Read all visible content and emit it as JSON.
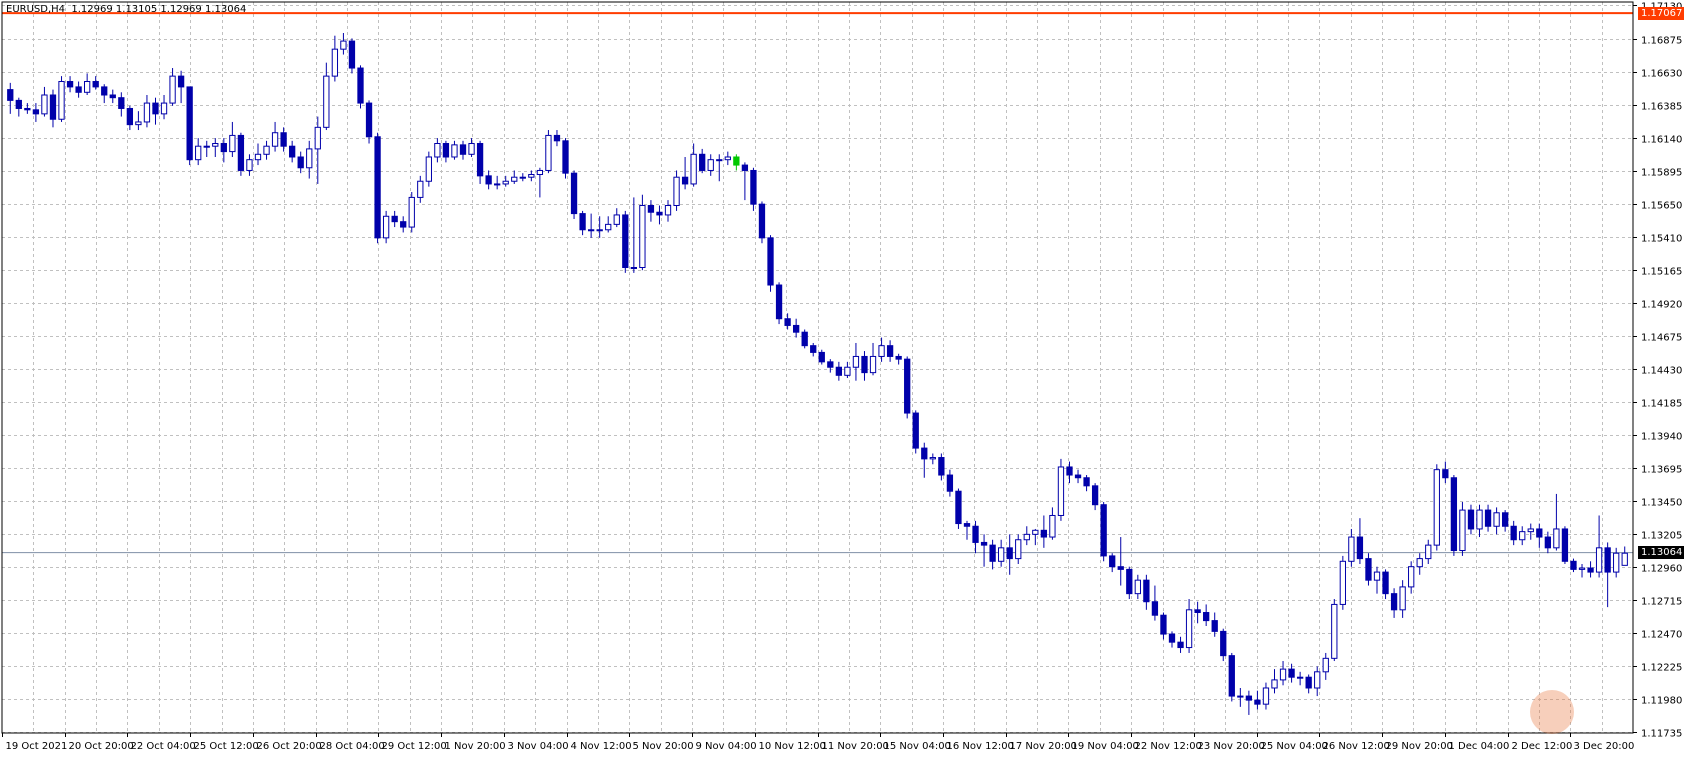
{
  "chart_data": {
    "type": "candlestick",
    "title": "EURUSD,H4  1.12969 1.13105 1.12969 1.13064",
    "symbol": "EURUSD",
    "timeframe": "H4",
    "ohlc_header": [
      "1.12969",
      "1.13105",
      "1.12969",
      "1.13064"
    ],
    "ylim": [
      1.11726,
      1.1715
    ],
    "y_ticks": [
      "1.17130",
      "1.16875",
      "1.16630",
      "1.16385",
      "1.16140",
      "1.15895",
      "1.15650",
      "1.15410",
      "1.15165",
      "1.14920",
      "1.14675",
      "1.14430",
      "1.14185",
      "1.13940",
      "1.13695",
      "1.13450",
      "1.13205",
      "1.12960",
      "1.12715",
      "1.12470",
      "1.12225",
      "1.11980",
      "1.11735"
    ],
    "x_ticks": [
      "19 Oct 2021",
      "20 Oct 20:00",
      "22 Oct 04:00",
      "25 Oct 12:00",
      "26 Oct 20:00",
      "28 Oct 04:00",
      "29 Oct 12:00",
      "1 Nov 20:00",
      "3 Nov 04:00",
      "4 Nov 12:00",
      "5 Nov 20:00",
      "9 Nov 04:00",
      "10 Nov 12:00",
      "11 Nov 20:00",
      "15 Nov 04:00",
      "16 Nov 12:00",
      "17 Nov 20:00",
      "19 Nov 04:00",
      "22 Nov 12:00",
      "23 Nov 20:00",
      "25 Nov 04:00",
      "26 Nov 12:00",
      "29 Nov 20:00",
      "1 Dec 04:00",
      "2 Dec 12:00",
      "3 Dec 20:00"
    ],
    "level_line": {
      "price": "1.17067",
      "color": "#ff3c00"
    },
    "bid_line": {
      "price": "1.13064",
      "color": "#000000"
    },
    "grid": true,
    "colors": {
      "bull": "#0000aa",
      "bear": "#0000aa",
      "highlight": "#00c800",
      "grid": "#c0c0c0"
    },
    "closes": [
      1.1642,
      1.1636,
      1.1635,
      1.1632,
      1.1646,
      1.1628,
      1.1656,
      1.1652,
      1.1648,
      1.1656,
      1.1652,
      1.1646,
      1.1644,
      1.1636,
      1.1624,
      1.1626,
      1.164,
      1.1632,
      1.164,
      1.166,
      1.1652,
      1.1598,
      1.1608,
      1.1608,
      1.161,
      1.1604,
      1.1616,
      1.159,
      1.1598,
      1.1602,
      1.1608,
      1.1618,
      1.1608,
      1.16,
      1.1592,
      1.1606,
      1.1622,
      1.166,
      1.168,
      1.1686,
      1.1666,
      1.164,
      1.1615,
      1.154,
      1.1556,
      1.1552,
      1.1548,
      1.157,
      1.1582,
      1.16,
      1.161,
      1.16,
      1.1609,
      1.1602,
      1.161,
      1.1586,
      1.158,
      1.158,
      1.1582,
      1.1585,
      1.1585,
      1.1587,
      1.159,
      1.1616,
      1.1612,
      1.1588,
      1.1558,
      1.1546,
      1.1546,
      1.1546,
      1.155,
      1.1557,
      1.1518,
      1.1518,
      1.1564,
      1.1559,
      1.1557,
      1.1564,
      1.1585,
      1.158,
      1.1602,
      1.159,
      1.1598,
      1.1598,
      1.16,
      1.1594,
      1.159,
      1.1565,
      1.154,
      1.1505,
      1.148,
      1.1475,
      1.147,
      1.146,
      1.1455,
      1.1448,
      1.1444,
      1.1438,
      1.1444,
      1.1452,
      1.144,
      1.1452,
      1.146,
      1.1452,
      1.145,
      1.141,
      1.1384,
      1.1376,
      1.1377,
      1.1364,
      1.1352,
      1.1328,
      1.1326,
      1.1314,
      1.1312,
      1.13,
      1.131,
      1.1302,
      1.1316,
      1.132,
      1.1323,
      1.1318,
      1.1334,
      1.137,
      1.1364,
      1.1362,
      1.1356,
      1.1342,
      1.1304,
      1.1296,
      1.1294,
      1.1276,
      1.1286,
      1.127,
      1.126,
      1.1246,
      1.124,
      1.1236,
      1.1264,
      1.1262,
      1.1256,
      1.1248,
      1.123,
      1.12,
      1.12,
      1.1197,
      1.1194,
      1.1206,
      1.1212,
      1.122,
      1.1214,
      1.1214,
      1.1206,
      1.1218,
      1.1228,
      1.1268,
      1.13,
      1.1318,
      1.1302,
      1.1286,
      1.1292,
      1.1276,
      1.1264,
      1.1281,
      1.1296,
      1.1302,
      1.1312,
      1.1368,
      1.1362,
      1.1308,
      1.1338,
      1.1324,
      1.1338,
      1.1326,
      1.1336,
      1.1326,
      1.1316,
      1.1322,
      1.1324,
      1.1318,
      1.131,
      1.1324,
      1.13,
      1.1294,
      1.1295,
      1.1292,
      1.131,
      1.1292,
      1.1306,
      1.1306
    ],
    "highlight_index": 85,
    "candles": [
      [
        1.165,
        1.1655,
        1.1632,
        1.1642
      ],
      [
        1.1642,
        1.1644,
        1.163,
        1.1636
      ],
      [
        1.1636,
        1.164,
        1.1632,
        1.1635
      ],
      [
        1.1635,
        1.164,
        1.1626,
        1.1632
      ],
      [
        1.1632,
        1.1652,
        1.163,
        1.1646
      ],
      [
        1.1646,
        1.165,
        1.1622,
        1.1628
      ],
      [
        1.1628,
        1.166,
        1.1626,
        1.1656
      ],
      [
        1.1656,
        1.166,
        1.1648,
        1.1652
      ],
      [
        1.1652,
        1.1656,
        1.1644,
        1.1648
      ],
      [
        1.1648,
        1.1662,
        1.1646,
        1.1656
      ],
      [
        1.1656,
        1.166,
        1.165,
        1.1652
      ],
      [
        1.1652,
        1.1654,
        1.164,
        1.1646
      ],
      [
        1.1646,
        1.165,
        1.164,
        1.1644
      ],
      [
        1.1644,
        1.1648,
        1.163,
        1.1636
      ],
      [
        1.1636,
        1.1638,
        1.162,
        1.1624
      ],
      [
        1.1624,
        1.1634,
        1.162,
        1.1626
      ],
      [
        1.1626,
        1.1646,
        1.1622,
        1.164
      ],
      [
        1.164,
        1.1644,
        1.1624,
        1.1632
      ],
      [
        1.1632,
        1.1646,
        1.1628,
        1.164
      ],
      [
        1.164,
        1.1666,
        1.1638,
        1.166
      ],
      [
        1.166,
        1.1664,
        1.164,
        1.1652
      ],
      [
        1.1652,
        1.1652,
        1.1594,
        1.1598
      ],
      [
        1.1598,
        1.1614,
        1.1594,
        1.1608
      ],
      [
        1.1608,
        1.1612,
        1.16,
        1.1608
      ],
      [
        1.1608,
        1.1614,
        1.16,
        1.161
      ],
      [
        1.161,
        1.1614,
        1.1596,
        1.1604
      ],
      [
        1.1604,
        1.1626,
        1.16,
        1.1616
      ],
      [
        1.1616,
        1.1618,
        1.1586,
        1.159
      ],
      [
        1.159,
        1.1602,
        1.1586,
        1.1598
      ],
      [
        1.1598,
        1.161,
        1.1594,
        1.1602
      ],
      [
        1.1602,
        1.1612,
        1.1598,
        1.1608
      ],
      [
        1.1608,
        1.1626,
        1.1604,
        1.1618
      ],
      [
        1.1618,
        1.1622,
        1.1604,
        1.1608
      ],
      [
        1.1608,
        1.1612,
        1.1596,
        1.16
      ],
      [
        1.16,
        1.1604,
        1.1588,
        1.1592
      ],
      [
        1.1592,
        1.1612,
        1.1584,
        1.1606
      ],
      [
        1.1606,
        1.163,
        1.158,
        1.1622
      ],
      [
        1.1622,
        1.167,
        1.162,
        1.166
      ],
      [
        1.166,
        1.169,
        1.1656,
        1.168
      ],
      [
        1.168,
        1.1692,
        1.1676,
        1.1686
      ],
      [
        1.1686,
        1.1688,
        1.1662,
        1.1666
      ],
      [
        1.1666,
        1.1668,
        1.1636,
        1.164
      ],
      [
        1.164,
        1.1642,
        1.161,
        1.1615
      ],
      [
        1.1615,
        1.1618,
        1.1536,
        1.154
      ],
      [
        1.154,
        1.156,
        1.1536,
        1.1556
      ],
      [
        1.1556,
        1.156,
        1.1548,
        1.1552
      ],
      [
        1.1552,
        1.1556,
        1.1544,
        1.1548
      ],
      [
        1.1548,
        1.1574,
        1.1544,
        1.157
      ],
      [
        1.157,
        1.1586,
        1.1566,
        1.1582
      ],
      [
        1.1582,
        1.1604,
        1.1578,
        1.16
      ],
      [
        1.16,
        1.1614,
        1.1596,
        1.161
      ],
      [
        1.161,
        1.1612,
        1.1596,
        1.16
      ],
      [
        1.16,
        1.1612,
        1.1598,
        1.1609
      ],
      [
        1.1609,
        1.1612,
        1.1598,
        1.1602
      ],
      [
        1.1602,
        1.1614,
        1.16,
        1.161
      ],
      [
        1.161,
        1.1612,
        1.158,
        1.1586
      ],
      [
        1.1586,
        1.159,
        1.1576,
        1.158
      ],
      [
        1.158,
        1.1586,
        1.1576,
        1.158
      ],
      [
        1.158,
        1.1586,
        1.1578,
        1.1582
      ],
      [
        1.1582,
        1.159,
        1.158,
        1.1585
      ],
      [
        1.1585,
        1.1588,
        1.1582,
        1.1585
      ],
      [
        1.1585,
        1.159,
        1.1582,
        1.1587
      ],
      [
        1.1587,
        1.1592,
        1.157,
        1.159
      ],
      [
        1.159,
        1.162,
        1.1588,
        1.1616
      ],
      [
        1.1616,
        1.162,
        1.1608,
        1.1612
      ],
      [
        1.1612,
        1.1614,
        1.1584,
        1.1588
      ],
      [
        1.1588,
        1.159,
        1.1554,
        1.1558
      ],
      [
        1.1558,
        1.156,
        1.1542,
        1.1546
      ],
      [
        1.1546,
        1.1558,
        1.154,
        1.1546
      ],
      [
        1.1546,
        1.1556,
        1.154,
        1.1546
      ],
      [
        1.1546,
        1.1556,
        1.1544,
        1.155
      ],
      [
        1.155,
        1.1562,
        1.1548,
        1.1557
      ],
      [
        1.1557,
        1.156,
        1.1514,
        1.1518
      ],
      [
        1.1518,
        1.157,
        1.1514,
        1.1518
      ],
      [
        1.1518,
        1.1572,
        1.1516,
        1.1564
      ],
      [
        1.1564,
        1.1568,
        1.1552,
        1.1559
      ],
      [
        1.1559,
        1.1564,
        1.155,
        1.1557
      ],
      [
        1.1557,
        1.1568,
        1.1552,
        1.1564
      ],
      [
        1.1564,
        1.159,
        1.156,
        1.1585
      ],
      [
        1.1585,
        1.16,
        1.1576,
        1.158
      ],
      [
        1.158,
        1.161,
        1.1578,
        1.1602
      ],
      [
        1.1602,
        1.1606,
        1.1588,
        1.159
      ],
      [
        1.159,
        1.1602,
        1.1586,
        1.1598
      ],
      [
        1.1598,
        1.1602,
        1.1582,
        1.1598
      ],
      [
        1.1598,
        1.1604,
        1.1594,
        1.16
      ],
      [
        1.16,
        1.1602,
        1.159,
        1.1594
      ],
      [
        1.1594,
        1.1596,
        1.1568,
        1.159
      ],
      [
        1.159,
        1.1592,
        1.156,
        1.1565
      ],
      [
        1.1565,
        1.1567,
        1.1536,
        1.154
      ],
      [
        1.154,
        1.1542,
        1.15,
        1.1505
      ],
      [
        1.1505,
        1.1507,
        1.1476,
        1.148
      ],
      [
        1.148,
        1.1484,
        1.1472,
        1.1475
      ],
      [
        1.1475,
        1.148,
        1.1466,
        1.147
      ],
      [
        1.147,
        1.1472,
        1.1458,
        1.146
      ],
      [
        1.146,
        1.1462,
        1.1452,
        1.1455
      ],
      [
        1.1455,
        1.1457,
        1.1446,
        1.1448
      ],
      [
        1.1448,
        1.145,
        1.144,
        1.1444
      ],
      [
        1.1444,
        1.1448,
        1.1434,
        1.1438
      ],
      [
        1.1438,
        1.1448,
        1.1436,
        1.1444
      ],
      [
        1.1444,
        1.1462,
        1.1434,
        1.1452
      ],
      [
        1.1452,
        1.1456,
        1.1434,
        1.144
      ],
      [
        1.144,
        1.1462,
        1.1438,
        1.1452
      ],
      [
        1.1452,
        1.1466,
        1.1448,
        1.146
      ],
      [
        1.146,
        1.1464,
        1.1448,
        1.1452
      ],
      [
        1.1452,
        1.1454,
        1.1446,
        1.145
      ],
      [
        1.145,
        1.1452,
        1.1406,
        1.141
      ],
      [
        1.141,
        1.1412,
        1.138,
        1.1384
      ],
      [
        1.1384,
        1.1388,
        1.1362,
        1.1376
      ],
      [
        1.1376,
        1.138,
        1.1372,
        1.1377
      ],
      [
        1.1377,
        1.138,
        1.136,
        1.1364
      ],
      [
        1.1364,
        1.1368,
        1.1348,
        1.1352
      ],
      [
        1.1352,
        1.1354,
        1.1324,
        1.1328
      ],
      [
        1.1328,
        1.133,
        1.1316,
        1.1326
      ],
      [
        1.1326,
        1.133,
        1.1306,
        1.1314
      ],
      [
        1.1314,
        1.132,
        1.1296,
        1.1312
      ],
      [
        1.1312,
        1.1316,
        1.1294,
        1.13
      ],
      [
        1.13,
        1.1316,
        1.1296,
        1.131
      ],
      [
        1.131,
        1.132,
        1.129,
        1.1302
      ],
      [
        1.1302,
        1.132,
        1.1298,
        1.1316
      ],
      [
        1.1316,
        1.1326,
        1.1312,
        1.132
      ],
      [
        1.132,
        1.1324,
        1.1312,
        1.1323
      ],
      [
        1.1323,
        1.1334,
        1.131,
        1.1318
      ],
      [
        1.1318,
        1.134,
        1.1316,
        1.1334
      ],
      [
        1.1334,
        1.1376,
        1.133,
        1.137
      ],
      [
        1.137,
        1.1374,
        1.1358,
        1.1364
      ],
      [
        1.1364,
        1.1368,
        1.1358,
        1.1362
      ],
      [
        1.1362,
        1.1364,
        1.1352,
        1.1356
      ],
      [
        1.1356,
        1.1358,
        1.1338,
        1.1342
      ],
      [
        1.1342,
        1.1344,
        1.13,
        1.1304
      ],
      [
        1.1304,
        1.1306,
        1.1292,
        1.1296
      ],
      [
        1.1296,
        1.1318,
        1.1282,
        1.1294
      ],
      [
        1.1294,
        1.1296,
        1.1272,
        1.1276
      ],
      [
        1.1276,
        1.129,
        1.1272,
        1.1286
      ],
      [
        1.1286,
        1.129,
        1.1264,
        1.127
      ],
      [
        1.127,
        1.1282,
        1.1256,
        1.126
      ],
      [
        1.126,
        1.1262,
        1.1242,
        1.1246
      ],
      [
        1.1246,
        1.1248,
        1.1236,
        1.124
      ],
      [
        1.124,
        1.1244,
        1.1232,
        1.1236
      ],
      [
        1.1236,
        1.1272,
        1.1232,
        1.1264
      ],
      [
        1.1264,
        1.127,
        1.1254,
        1.1262
      ],
      [
        1.1262,
        1.1268,
        1.1252,
        1.1256
      ],
      [
        1.1256,
        1.1262,
        1.1244,
        1.1248
      ],
      [
        1.1248,
        1.125,
        1.1226,
        1.123
      ],
      [
        1.123,
        1.1232,
        1.1196,
        1.12
      ],
      [
        1.12,
        1.1206,
        1.1192,
        1.12
      ],
      [
        1.12,
        1.1204,
        1.1186,
        1.1197
      ],
      [
        1.1197,
        1.1204,
        1.119,
        1.1194
      ],
      [
        1.1194,
        1.121,
        1.119,
        1.1206
      ],
      [
        1.1206,
        1.122,
        1.1202,
        1.1212
      ],
      [
        1.1212,
        1.1226,
        1.1208,
        1.122
      ],
      [
        1.122,
        1.1224,
        1.121,
        1.1214
      ],
      [
        1.1214,
        1.1218,
        1.1208,
        1.1214
      ],
      [
        1.1214,
        1.1216,
        1.1202,
        1.1206
      ],
      [
        1.1206,
        1.1222,
        1.12,
        1.1218
      ],
      [
        1.1218,
        1.1232,
        1.1212,
        1.1228
      ],
      [
        1.1228,
        1.1272,
        1.1226,
        1.1268
      ],
      [
        1.1268,
        1.1304,
        1.1264,
        1.13
      ],
      [
        1.13,
        1.1324,
        1.1296,
        1.1318
      ],
      [
        1.1318,
        1.1332,
        1.1298,
        1.1302
      ],
      [
        1.1302,
        1.1306,
        1.1282,
        1.1286
      ],
      [
        1.1286,
        1.1296,
        1.1276,
        1.1292
      ],
      [
        1.1292,
        1.1294,
        1.1272,
        1.1276
      ],
      [
        1.1276,
        1.128,
        1.1258,
        1.1264
      ],
      [
        1.1264,
        1.1286,
        1.1258,
        1.1281
      ],
      [
        1.1281,
        1.13,
        1.1276,
        1.1296
      ],
      [
        1.1296,
        1.1306,
        1.129,
        1.1302
      ],
      [
        1.1302,
        1.1316,
        1.1298,
        1.1312
      ],
      [
        1.1312,
        1.1372,
        1.1308,
        1.1368
      ],
      [
        1.1368,
        1.1374,
        1.1358,
        1.1362
      ],
      [
        1.1362,
        1.1364,
        1.1304,
        1.1308
      ],
      [
        1.1308,
        1.1344,
        1.1304,
        1.1338
      ],
      [
        1.1338,
        1.1342,
        1.132,
        1.1324
      ],
      [
        1.1324,
        1.1342,
        1.1318,
        1.1338
      ],
      [
        1.1338,
        1.1342,
        1.1322,
        1.1326
      ],
      [
        1.1326,
        1.134,
        1.132,
        1.1336
      ],
      [
        1.1336,
        1.1338,
        1.1322,
        1.1326
      ],
      [
        1.1326,
        1.133,
        1.1312,
        1.1316
      ],
      [
        1.1316,
        1.1326,
        1.1312,
        1.1322
      ],
      [
        1.1322,
        1.1328,
        1.1316,
        1.1324
      ],
      [
        1.1324,
        1.1328,
        1.131,
        1.1318
      ],
      [
        1.1318,
        1.1322,
        1.1306,
        1.131
      ],
      [
        1.131,
        1.135,
        1.1308,
        1.1324
      ],
      [
        1.1324,
        1.1326,
        1.1298,
        1.13
      ],
      [
        1.13,
        1.1302,
        1.1292,
        1.1294
      ],
      [
        1.1294,
        1.1298,
        1.1288,
        1.1295
      ],
      [
        1.1295,
        1.13,
        1.1288,
        1.1292
      ],
      [
        1.1292,
        1.1334,
        1.1288,
        1.131
      ],
      [
        1.131,
        1.1314,
        1.1266,
        1.1292
      ],
      [
        1.1292,
        1.131,
        1.1288,
        1.1306
      ],
      [
        1.1297,
        1.1311,
        1.1297,
        1.1306
      ]
    ]
  }
}
